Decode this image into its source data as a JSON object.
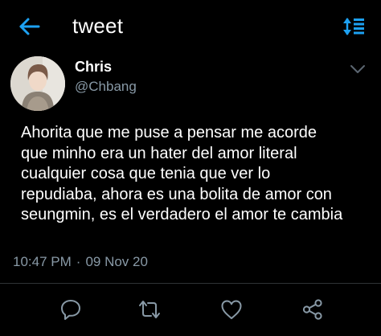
{
  "header": {
    "title": "tweet"
  },
  "tweet": {
    "author_name": "Chris",
    "author_handle": "@Chbang",
    "lines": [
      "Ahorita que me puse a pensar me acorde",
      "que minho era un hater del amor literal",
      "cualquier cosa que tenia que ver lo",
      "repudiaba, ahora es una bolita de amor con",
      "seungmin, es el verdadero el amor te cambia"
    ],
    "time": "10:47 PM",
    "separator": "·",
    "date": "09 Nov 20"
  },
  "icons": {
    "back": "arrow-left-icon",
    "sort": "sort-icon",
    "more": "chevron-down-icon",
    "reply": "reply-icon",
    "retweet": "retweet-icon",
    "like": "heart-icon",
    "share": "share-icon"
  },
  "colors": {
    "accent": "#1da1f2",
    "background": "#000000",
    "secondary_text": "#8899a6",
    "action_icon": "#8899a6"
  }
}
